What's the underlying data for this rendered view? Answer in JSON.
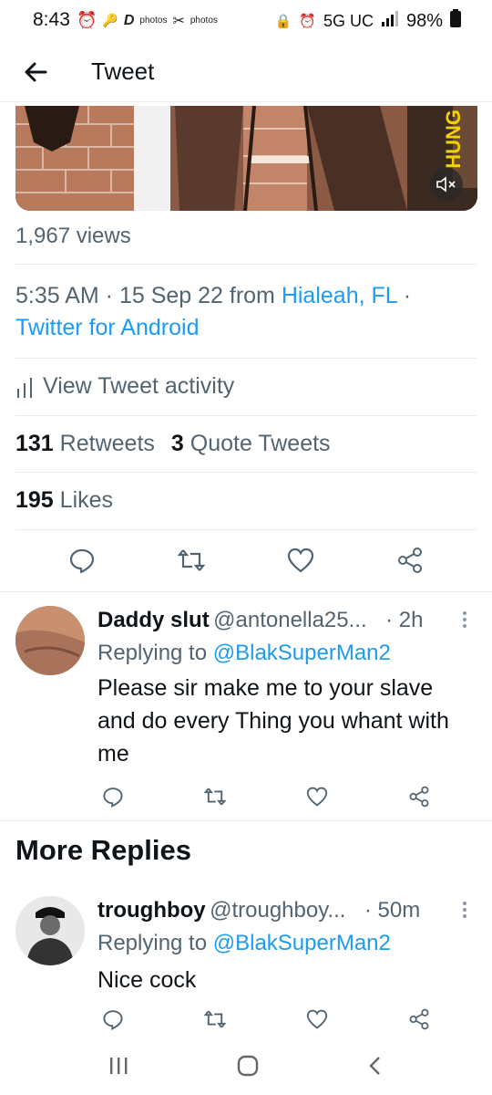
{
  "status_bar": {
    "time": "8:43",
    "network": "5G UC",
    "battery": "98%",
    "left_icons": [
      "alarm-icon",
      "key-icon",
      "d-icon",
      "photos-icon",
      "scissors-icon",
      "photos-icon"
    ]
  },
  "header": {
    "title": "Tweet"
  },
  "media": {
    "overlay_text": "HUNG"
  },
  "tweet": {
    "views": "1,967 views",
    "time": "5:35 AM · 15 Sep 22 from ",
    "location": "Hialeah, FL",
    "separator": " ·",
    "source": "Twitter for Android",
    "activity_label": "View Tweet activity",
    "retweets_count": "131",
    "retweets_label": "Retweets",
    "quotes_count": "3",
    "quotes_label": "Quote Tweets",
    "likes_count": "195",
    "likes_label": "Likes"
  },
  "replies": [
    {
      "name": "Daddy slut",
      "handle": "@antonella25...",
      "age": "· 2h",
      "replying_prefix": "Replying to ",
      "replying_to": "@BlakSuperMan2",
      "text": "Please sir make me to your slave and do every Thing you whant with me"
    }
  ],
  "more_replies": {
    "title": "More Replies",
    "items": [
      {
        "name": "troughboy",
        "handle": "@troughboy...",
        "age": "· 50m",
        "replying_prefix": "Replying to ",
        "replying_to": "@BlakSuperMan2",
        "text": "Nice cock"
      }
    ]
  },
  "colors": {
    "accent": "#1d9bf0",
    "secondary_text": "#536471",
    "primary_text": "#0f1419",
    "divider": "#e6ecf0"
  }
}
